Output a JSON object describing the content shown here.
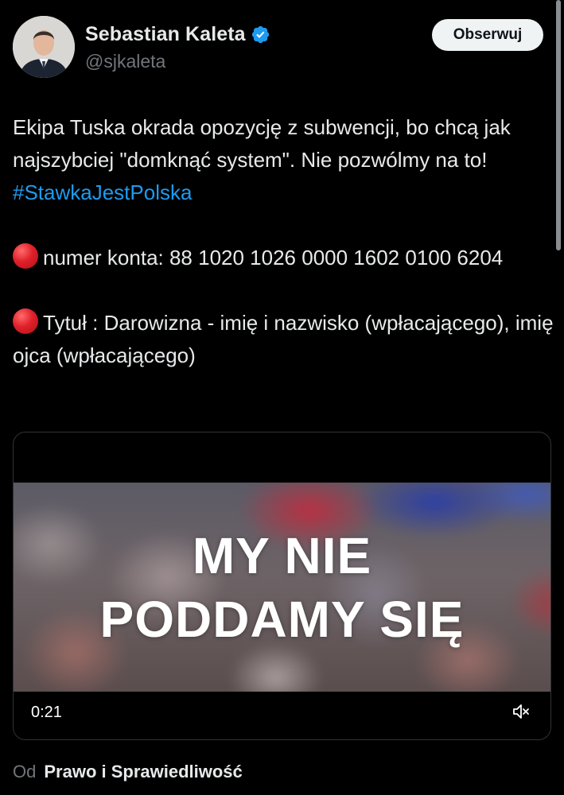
{
  "author": {
    "display_name": "Sebastian Kaleta",
    "handle": "@sjkaleta",
    "verified": true
  },
  "follow_button": {
    "label": "Obserwuj"
  },
  "tweet": {
    "text_part1": "Ekipa Tuska okrada opozycję z subwencji, bo chcą jak najszybciej \"domknąć system\". Nie pozwólmy na to! ",
    "hashtag": "#StawkaJestPolska",
    "account_line": "numer konta: 88 1020 1026 0000 1602 0100 6204",
    "title_line": "Tytuł : Darowizna - imię i nazwisko (wpłacającego), imię ojca (wpłacającego)"
  },
  "video": {
    "title_line1": "MY NIE",
    "title_line2": "PODDAMY SIĘ",
    "time": "0:21"
  },
  "source": {
    "prefix": "Od",
    "name": "Prawo i Sprawiedliwość"
  },
  "colors": {
    "background": "#000000",
    "text": "#e7e9ea",
    "secondary_text": "#71767b",
    "link": "#1d9bf0",
    "verified_badge": "#1d9bf0",
    "follow_button_bg": "#eff3f4"
  },
  "icons": {
    "verified": "verified-badge-icon",
    "bullet": "red-circle-emoji",
    "mute": "speaker-muted-icon"
  }
}
